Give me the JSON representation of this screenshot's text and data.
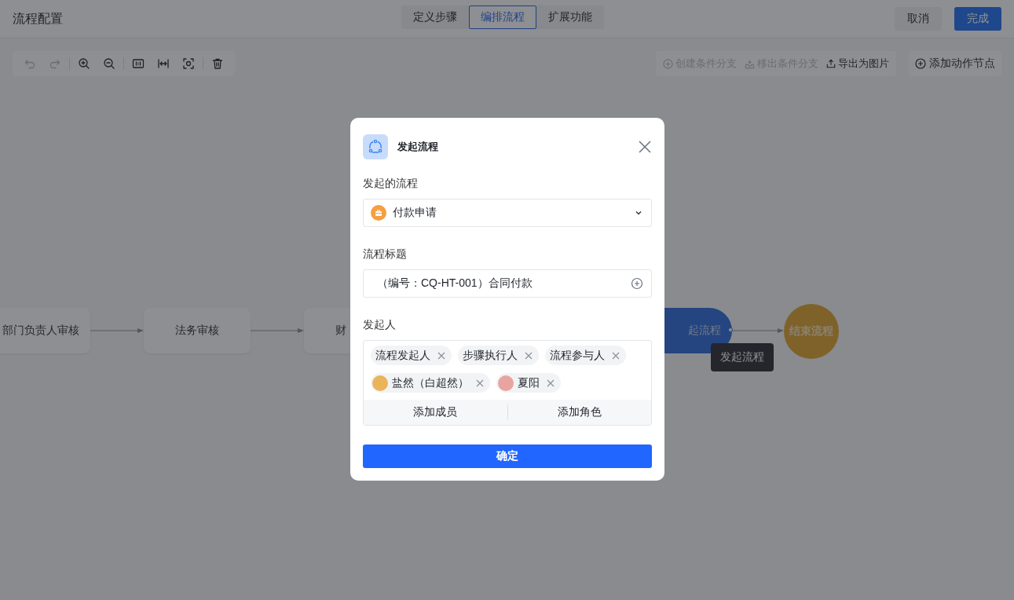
{
  "header": {
    "title": "流程配置",
    "tabs": [
      {
        "label": "定义步骤",
        "selected": false
      },
      {
        "label": "编排流程",
        "selected": true
      },
      {
        "label": "扩展功能",
        "selected": false
      }
    ],
    "buttons": [
      {
        "label": "取消",
        "kind": "secondary"
      },
      {
        "label": "完成",
        "kind": "primary"
      }
    ]
  },
  "toolbar": {
    "tools": [
      {
        "kind": "undo",
        "disabled": true
      },
      {
        "kind": "redo",
        "disabled": true
      },
      {
        "kind": "zoom-in",
        "disabled": false
      },
      {
        "kind": "zoom-out",
        "disabled": false
      },
      {
        "kind": "actual-size",
        "disabled": false
      },
      {
        "kind": "fit-width",
        "disabled": false
      },
      {
        "kind": "fit-view",
        "disabled": false
      },
      {
        "kind": "delete",
        "disabled": false
      }
    ],
    "actions": [
      {
        "label": "创建条件分支",
        "kind": "add-branch",
        "disabled": true
      },
      {
        "label": "移出条件分支",
        "kind": "remove-branch",
        "disabled": true
      },
      {
        "label": "导出为图片",
        "kind": "export",
        "disabled": false
      }
    ],
    "add_node": {
      "label": "添加动作节点"
    }
  },
  "canvas": {
    "nodes": [
      {
        "label": "部门负责人审核",
        "kind": "task"
      },
      {
        "label": "法务审核",
        "kind": "task"
      },
      {
        "label": "财",
        "kind": "task"
      },
      {
        "label": "起流程",
        "kind": "start-flow"
      },
      {
        "label": "结束流程",
        "kind": "end"
      }
    ],
    "tooltip": "发起流程"
  },
  "dialog": {
    "title": "发起流程",
    "process": {
      "label": "发起的流程",
      "value": "付款申请"
    },
    "flow_title": {
      "label": "流程标题",
      "value": "（编号：CQ-HT-001）合同付款"
    },
    "initiators": {
      "label": "发起人",
      "tags": [
        {
          "label": "流程发起人",
          "kind": "role"
        },
        {
          "label": "步骤执行人",
          "kind": "role"
        },
        {
          "label": "流程参与人",
          "kind": "role"
        },
        {
          "label": "盐然（白超然）",
          "kind": "member",
          "color": "#e9b45a"
        },
        {
          "label": "夏阳",
          "kind": "member",
          "color": "#e8a4a0"
        }
      ],
      "add_buttons": [
        "添加成员",
        "添加角色"
      ]
    },
    "confirm": "确定"
  }
}
